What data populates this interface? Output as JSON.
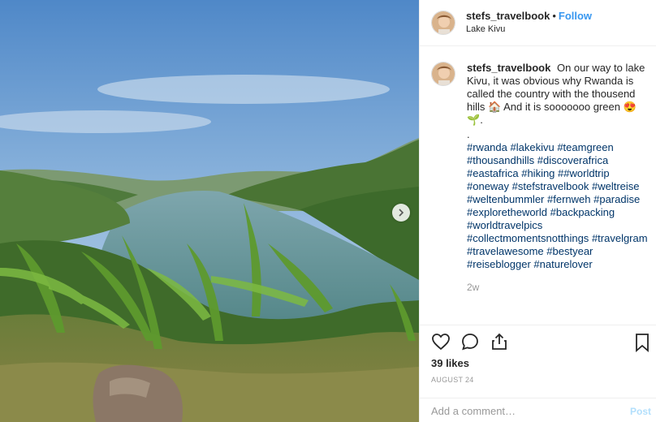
{
  "post": {
    "username": "stefs_travelbook",
    "separator": "•",
    "follow_label": "Follow",
    "location": "Lake Kivu",
    "photo_next_icon": "chevron-right-icon"
  },
  "caption": {
    "username": "stefs_travelbook",
    "text_1": "On our way to lake Kivu, it was obvious why Rwanda is called the country with the thousend hills",
    "emoji_house": "🏠",
    "text_2": "And it is sooooooo green",
    "emoji_heart_eyes": "😍",
    "emoji_seedling": "🌱",
    "text_3": ".",
    "dot_line": ".",
    "hashtags": [
      "#rwanda",
      "#lakekivu",
      "#teamgreen",
      "#thousandhills",
      "#discoverafrica",
      "#eastafrica",
      "#hiking",
      "##worldtrip",
      "#oneway",
      "#stefstravelbook",
      "#weltreise",
      "#weltenbummler",
      "#fernweh",
      "#paradise",
      "#exploretheworld",
      "#backpacking",
      "#worldtravelpics",
      "#collectmomentsnotthings",
      "#travelgram",
      "#travelawesome",
      "#bestyear",
      "#reiseblogger",
      "#naturelover"
    ],
    "time_ago": "2w"
  },
  "actions": {
    "like_icon": "heart-icon",
    "comment_icon": "comment-bubble-icon",
    "share_icon": "share-icon",
    "save_icon": "bookmark-icon",
    "likes": "39 likes",
    "date": "AUGUST 24"
  },
  "comment": {
    "placeholder": "Add a comment…",
    "post_label": "Post"
  },
  "colors": {
    "link_blue": "#3897f0",
    "hashtag_blue": "#003569",
    "muted": "#999999",
    "post_disabled": "#b2dffc"
  }
}
